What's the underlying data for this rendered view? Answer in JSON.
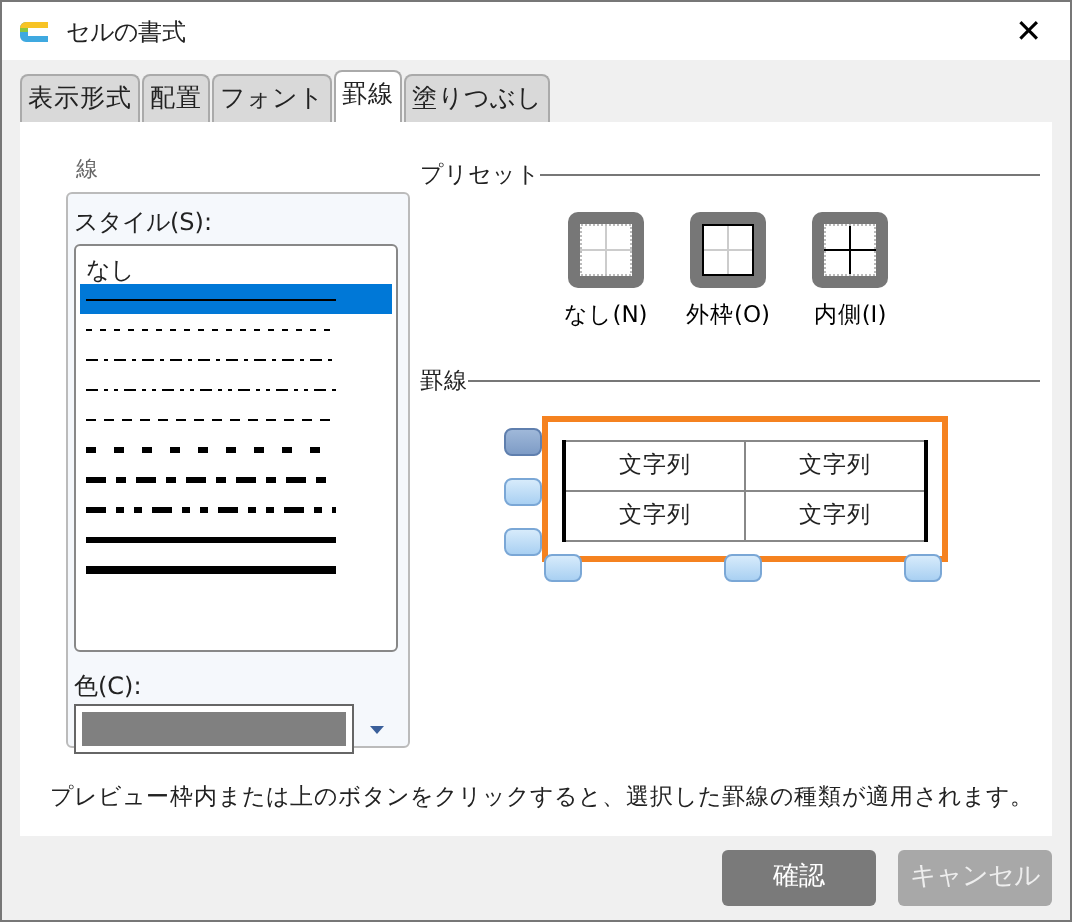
{
  "window": {
    "title": "セルの書式",
    "close": "✕"
  },
  "tabs": [
    {
      "label": "表示形式",
      "selected": false
    },
    {
      "label": "配置",
      "selected": false
    },
    {
      "label": "フォント",
      "selected": false
    },
    {
      "label": "罫線",
      "selected": true
    },
    {
      "label": "塗りつぶし",
      "selected": false
    }
  ],
  "line_group": {
    "title": "線",
    "style_label": "スタイル(S):",
    "styles": [
      {
        "kind": "text",
        "label": "なし",
        "selected": false
      },
      {
        "kind": "line",
        "selected": true
      },
      {
        "kind": "line",
        "selected": false
      },
      {
        "kind": "line",
        "selected": false
      },
      {
        "kind": "line",
        "selected": false
      },
      {
        "kind": "line",
        "selected": false
      },
      {
        "kind": "line",
        "selected": false
      },
      {
        "kind": "line",
        "selected": false
      },
      {
        "kind": "line",
        "selected": false
      },
      {
        "kind": "line",
        "selected": false
      },
      {
        "kind": "line",
        "selected": false
      }
    ],
    "color_label": "色(C):",
    "color": "#808080"
  },
  "presets": {
    "title": "プリセット",
    "items": [
      {
        "kind": "none",
        "label": "なし(N)"
      },
      {
        "kind": "outline",
        "label": "外枠(O)"
      },
      {
        "kind": "inside",
        "label": "内側(I)"
      }
    ]
  },
  "borders": {
    "title": "罫線",
    "row_toggles": [
      {
        "selected": true
      },
      {
        "selected": false
      },
      {
        "selected": false
      }
    ],
    "column_toggles": [
      {
        "selected": false
      },
      {
        "selected": false
      },
      {
        "selected": false
      }
    ],
    "cells": [
      "文字列",
      "文字列",
      "文字列",
      "文字列"
    ]
  },
  "hint": "プレビュー枠内または上のボタンをクリックすると、選択した罫線の種類が適用されます。",
  "buttons": [
    {
      "label": "確認",
      "disabled": false
    },
    {
      "label": "キャンセル",
      "disabled": true
    }
  ]
}
